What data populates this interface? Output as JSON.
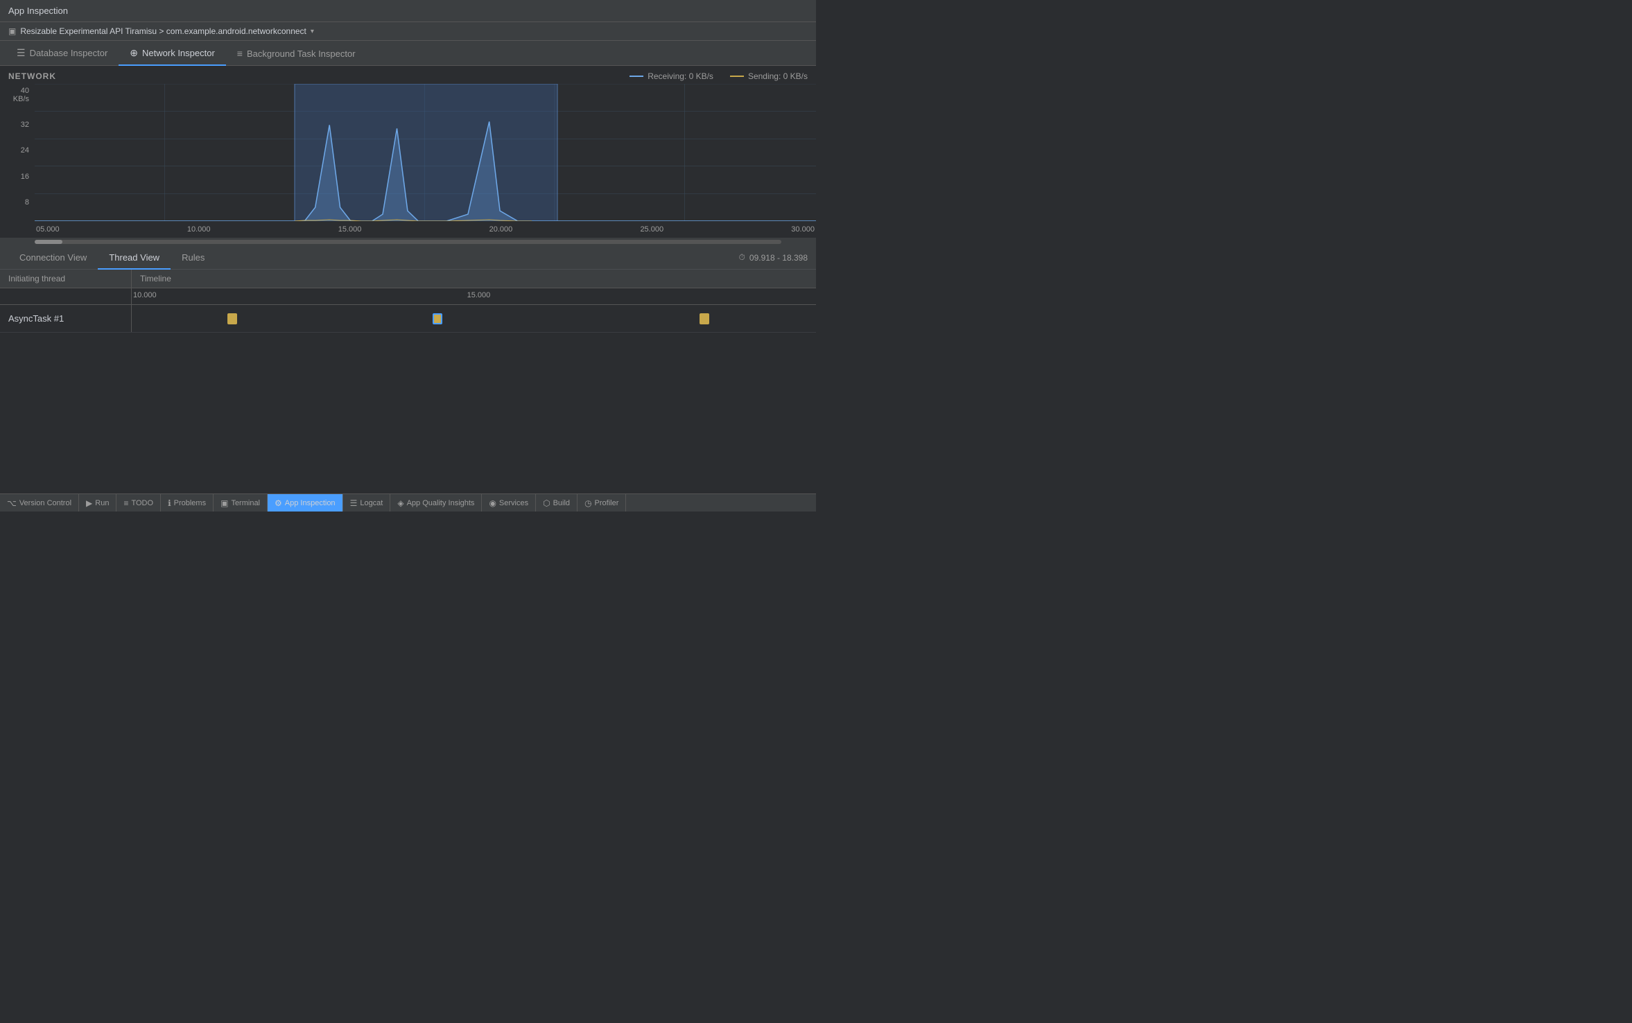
{
  "title_bar": {
    "label": "App Inspection"
  },
  "device_bar": {
    "device_icon": "▣",
    "device_text": "Resizable Experimental API Tiramisu > com.example.android.networkconnect",
    "dropdown_arrow": "▾"
  },
  "inspector_tabs": [
    {
      "id": "database",
      "icon": "☰",
      "label": "Database Inspector",
      "active": false
    },
    {
      "id": "network",
      "icon": "⊕",
      "label": "Network Inspector",
      "active": true
    },
    {
      "id": "background",
      "icon": "≡",
      "label": "Background Task Inspector",
      "active": false
    }
  ],
  "network_chart": {
    "title": "NETWORK",
    "y_axis": {
      "top_label": "40 KB/s",
      "labels": [
        "32",
        "24",
        "16",
        "8",
        ""
      ]
    },
    "legend": {
      "receiving_label": "Receiving: 0 KB/s",
      "sending_label": "Sending: 0 KB/s"
    },
    "x_axis_labels": [
      "05.000",
      "10.000",
      "15.000",
      "20.000",
      "25.000",
      "30.000"
    ]
  },
  "view_tabs": [
    {
      "id": "connection",
      "label": "Connection View",
      "active": false
    },
    {
      "id": "thread",
      "label": "Thread View",
      "active": true
    },
    {
      "id": "rules",
      "label": "Rules",
      "active": false
    }
  ],
  "time_range": {
    "icon": "⏱",
    "value": "09.918 - 18.398"
  },
  "thread_table": {
    "header": {
      "col1": "Initiating thread",
      "col2": "Timeline"
    },
    "timeline_ticks": [
      "10.000",
      "15.000"
    ],
    "rows": [
      {
        "label": "AsyncTask #1",
        "blocks": [
          {
            "left_pct": 14,
            "selected": false
          },
          {
            "left_pct": 44,
            "selected": true
          },
          {
            "left_pct": 83,
            "selected": false
          }
        ]
      }
    ]
  },
  "status_bar": {
    "items": [
      {
        "id": "version-control",
        "icon": "⌥",
        "label": "Version Control"
      },
      {
        "id": "run",
        "icon": "▶",
        "label": "Run"
      },
      {
        "id": "todo",
        "icon": "≡",
        "label": "TODO"
      },
      {
        "id": "problems",
        "icon": "ℹ",
        "label": "Problems"
      },
      {
        "id": "terminal",
        "icon": "▣",
        "label": "Terminal"
      },
      {
        "id": "app-inspection",
        "icon": "⚙",
        "label": "App Inspection",
        "active": true
      },
      {
        "id": "logcat",
        "icon": "☰",
        "label": "Logcat"
      },
      {
        "id": "app-quality",
        "icon": "◈",
        "label": "App Quality Insights"
      },
      {
        "id": "services",
        "icon": "◉",
        "label": "Services"
      },
      {
        "id": "build",
        "icon": "⬡",
        "label": "Build"
      },
      {
        "id": "profiler",
        "icon": "◷",
        "label": "Profiler"
      }
    ]
  }
}
